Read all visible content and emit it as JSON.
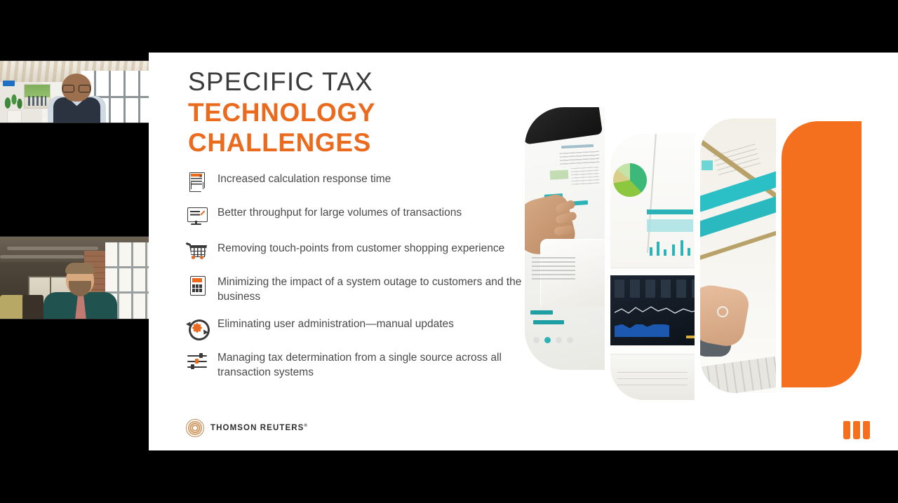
{
  "meeting": {
    "participants": [
      {
        "name": "participant-tile-1",
        "description": "Man with glasses in dark vest and light blue shirt, modern bright office with wood slat ceiling and tall windows"
      },
      {
        "name": "participant-tile-2",
        "description": "Bearded man in teal blazer, loft interior with exposed brick, pipes and large industrial window"
      }
    ]
  },
  "slide": {
    "title": {
      "line1": "SPECIFIC TAX",
      "line2": "TECHNOLOGY",
      "line3": "CHALLENGES"
    },
    "bullets": [
      {
        "icon": "document-invoice-icon",
        "text": "Increased calculation response time"
      },
      {
        "icon": "monitor-edit-icon",
        "text": "Better throughput for large volumes of transactions"
      },
      {
        "icon": "shopping-cart-icon",
        "text": "Removing touch-points from customer shopping experience"
      },
      {
        "icon": "calculator-icon",
        "text": "Minimizing the impact of a system outage to customers and the business"
      },
      {
        "icon": "refresh-gear-icon",
        "text": "Eliminating user administration—manual updates"
      },
      {
        "icon": "sliders-icon",
        "text": "Managing tax determination from a single source across all transaction systems"
      }
    ],
    "footer": {
      "brand": "THOMSON REUTERS",
      "brand_trademark": "®",
      "brand_mark": "thomson-reuters-kinesis-icon",
      "product_mark": "onesource-three-bars-icon"
    },
    "graphic": {
      "panels": [
        {
          "name": "photo-panel-tablet-report",
          "type": "photo"
        },
        {
          "name": "photo-panel-pie-chart-monitor",
          "type": "photo"
        },
        {
          "name": "photo-panel-highlighted-chart-mouse",
          "type": "photo"
        },
        {
          "name": "orange-accent-panel",
          "type": "solid"
        }
      ]
    }
  },
  "colors": {
    "accent_orange": "#ea6a1e",
    "panel_orange": "#f4701e",
    "title_gray": "#3b3b3b",
    "body_gray": "#4a4a4a",
    "slide_background": "#ffffff",
    "app_background": "#000000",
    "teal": "#2bb3b8"
  }
}
